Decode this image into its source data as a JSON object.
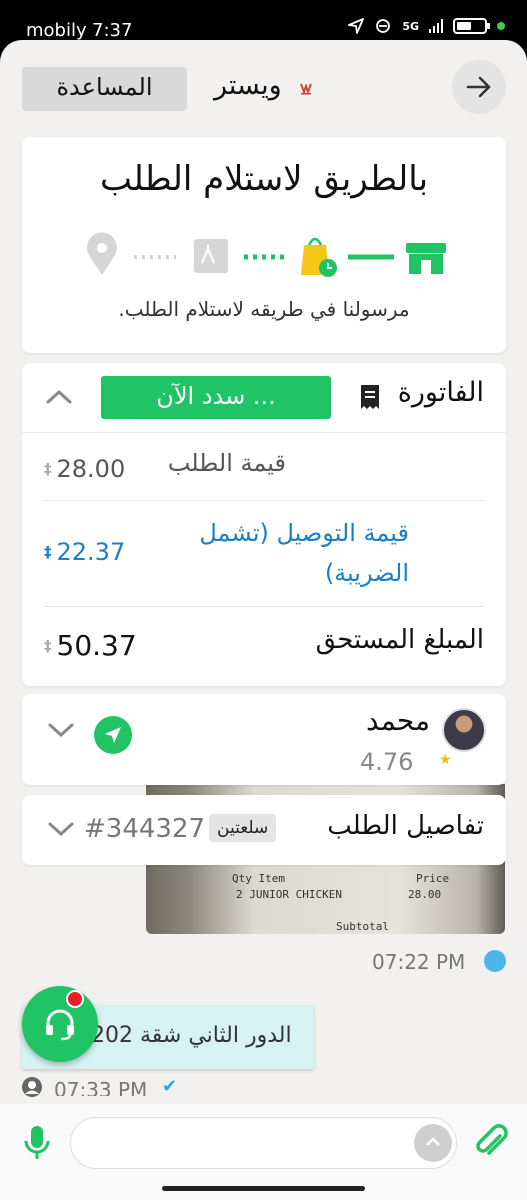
{
  "status_bar": {
    "carrier": "mobily",
    "time": "7:37",
    "network": "5G"
  },
  "topbar": {
    "help_label": "المساعدة",
    "store_name": "ويستر"
  },
  "order_status": {
    "title": "بالطريق لاستلام الطلب",
    "subtitle": "مرسولنا في طريقه لاستلام الطلب.",
    "steps_completed": 2,
    "steps_total": 4
  },
  "invoice": {
    "title": "الفاتورة",
    "pay_label": "سدد الآن ...",
    "order_value_label": "قيمة الطلب",
    "order_value": "28.00",
    "delivery_label": "قيمة التوصيل (تشمل الضريبة)",
    "delivery_value": "22.37",
    "total_label": "المبلغ المستحق",
    "total_value": "50.37"
  },
  "driver": {
    "name": "محمد",
    "rating": "4.76"
  },
  "order_details": {
    "title": "تفاصيل الطلب",
    "items_badge": "سلعتين",
    "order_number": "#344327"
  },
  "chat": {
    "time_1": "07:22 PM",
    "message": "الدور الثاني شقة 202",
    "time_2": "07:33 PM",
    "input_placeholder": ""
  },
  "colors": {
    "accent": "#20c464",
    "link": "#1a7fc8",
    "bubble": "#d6f2f3"
  }
}
